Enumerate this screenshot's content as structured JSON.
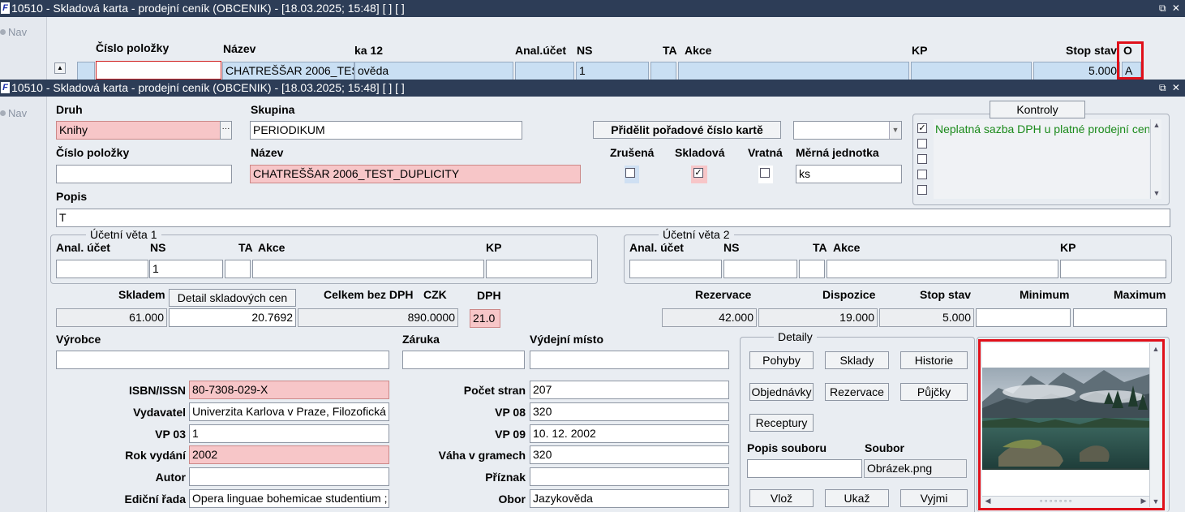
{
  "window1": {
    "title": "10510 - Skladová karta - prodejní ceník (OBCENIK) - [18.03.2025; 15:48]  [ ]  [ ]",
    "nav": "Nav",
    "columns": {
      "cislo_polozky": "Číslo položky",
      "nazev": "Název",
      "ka12": "ka 12",
      "anal_ucet": "Anal.účet",
      "ns": "NS",
      "ta": "TA",
      "akce": "Akce",
      "kp": "KP",
      "stop_stav": "Stop stav",
      "o": "O"
    },
    "row": {
      "cislo_polozky": "",
      "nazev": "CHATREŠŠAR 2006_TES",
      "ka12": "ověda",
      "anal_ucet": "",
      "ns": "1",
      "ta": "",
      "akce": "",
      "kp": "",
      "stop_stav": "5.000",
      "o": "A"
    }
  },
  "window2": {
    "title": "10510 - Skladová karta - prodejní ceník (OBCENIK) - [18.03.2025; 15:48]  [ ]  [ ]",
    "nav": "Nav"
  },
  "form": {
    "druh_label": "Druh",
    "druh_value": "Knihy",
    "skupina_label": "Skupina",
    "skupina_value": "PERIODIKUM",
    "pridelit_button": "Přidělit pořadové číslo kartě",
    "kontroly_button": "Kontroly",
    "kontroly_message": "Neplatná sazba DPH u platné prodejní cen",
    "cislo_polozky_label": "Číslo položky",
    "cislo_polozky_value": "",
    "nazev_label": "Název",
    "nazev_value": "CHATREŠŠAR 2006_TEST_DUPLICITY",
    "zrusena_label": "Zrušená",
    "skladova_label": "Skladová",
    "vratna_label": "Vratná",
    "merna_jednotka_label": "Měrná jednotka",
    "merna_jednotka_value": "ks",
    "popis_label": "Popis",
    "popis_value": "T"
  },
  "ucetni_veta_1": {
    "title": "Účetní věta 1",
    "anal_ucet": "Anal. účet",
    "ns": "NS",
    "ta": "TA",
    "akce": "Akce",
    "kp": "KP",
    "ns_value": "1"
  },
  "ucetni_veta_2": {
    "title": "Účetní věta 2",
    "anal_ucet": "Anal. účet",
    "ns": "NS",
    "ta": "TA",
    "akce": "Akce",
    "kp": "KP"
  },
  "stock": {
    "skladem_label": "Skladem",
    "detail_button": "Detail skladových cen",
    "celkem_label": "Celkem bez DPH",
    "czk_label": "CZK",
    "dph_label": "DPH",
    "skladem_value": "61.000",
    "cena_value": "20.7692",
    "celkem_value": "890.0000",
    "dph_value": "21.0",
    "rezervace_label": "Rezervace",
    "dispozice_label": "Dispozice",
    "stop_stav_label": "Stop stav",
    "minimum_label": "Minimum",
    "maximum_label": "Maximum",
    "rezervace_value": "42.000",
    "dispozice_value": "19.000",
    "stop_stav_value": "5.000",
    "minimum_value": "",
    "maximum_value": ""
  },
  "book": {
    "vyrobce_label": "Výrobce",
    "zaruka_label": "Záruka",
    "vydejni_misto_label": "Výdejní místo",
    "isbn_label": "ISBN/ISSN",
    "isbn_value": "80-7308-029-X",
    "vydavatel_label": "Vydavatel",
    "vydavatel_value": "Univerzita Karlova v Praze, Filozofická f",
    "vp03_label": "VP 03",
    "vp03_value": "1",
    "rok_label": "Rok vydání",
    "rok_value": "2002",
    "autor_label": "Autor",
    "autor_value": "",
    "edicni_label": "Ediční řada",
    "edicni_value": "Opera linguae bohemicae studentium ;",
    "pocet_stran_label": "Počet stran",
    "pocet_stran_value": "207",
    "vp08_label": "VP 08",
    "vp08_value": "320",
    "vp09_label": "VP 09",
    "vp09_value": "10. 12. 2002",
    "vaha_label": "Váha v gramech",
    "vaha_value": "320",
    "priznak_label": "Příznak",
    "priznak_value": "",
    "obor_label": "Obor",
    "obor_value": "Jazykověda"
  },
  "detaily": {
    "title": "Detaily",
    "pohyby": "Pohyby",
    "sklady": "Sklady",
    "historie": "Historie",
    "objednavky": "Objednávky",
    "rezervace": "Rezervace",
    "pujcky": "Půjčky",
    "receptury": "Receptury",
    "popis_souboru_label": "Popis souboru",
    "soubor_label": "Soubor",
    "popis_souboru_value": "",
    "soubor_value": "Obrázek.png",
    "vloz": "Vlož",
    "ukaz": "Ukaž",
    "vyjmi": "Vyjmi"
  },
  "colors": {
    "titlebar": "#2d3d57",
    "required_field": "#f7c6c8",
    "highlight": "#e0101a",
    "message_text": "#1a8a1a"
  }
}
